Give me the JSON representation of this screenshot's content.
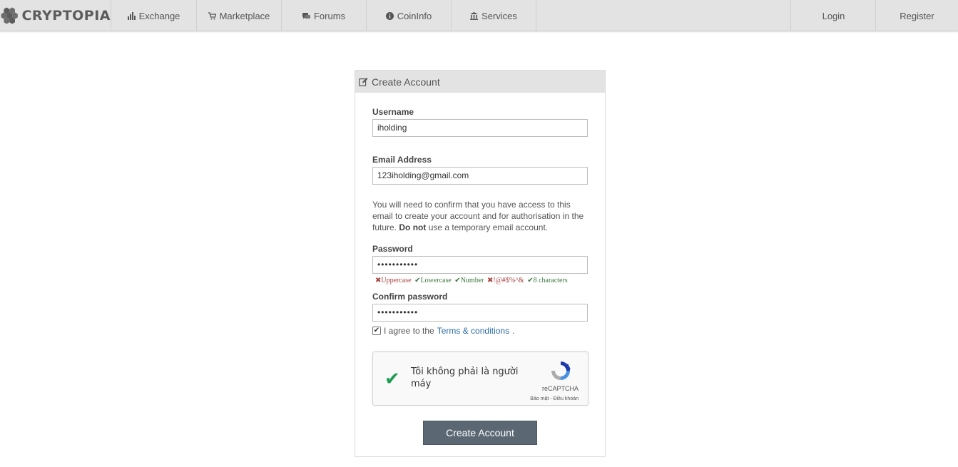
{
  "nav": {
    "brand": "CRYPTOPIA",
    "items": [
      {
        "label": "Exchange",
        "icon": "bar-chart-icon"
      },
      {
        "label": "Marketplace",
        "icon": "cart-icon"
      },
      {
        "label": "Forums",
        "icon": "comments-icon"
      },
      {
        "label": "CoinInfo",
        "icon": "info-circle-icon"
      },
      {
        "label": "Services",
        "icon": "bank-icon"
      }
    ],
    "login": "Login",
    "register": "Register"
  },
  "panel": {
    "title": "Create Account",
    "title_icon": "edit-icon"
  },
  "form": {
    "username_label": "Username",
    "username_value": "iholding",
    "email_label": "Email Address",
    "email_value": "123iholding@gmail.com",
    "email_help_1": "You will need to confirm that you have access to this email to create your account and for authorisation in the future. ",
    "email_help_bold": "Do not",
    "email_help_2": " use a temporary email account.",
    "password_label": "Password",
    "password_value": "•••••••••••",
    "password_rules": [
      {
        "text": "Uppercase",
        "status": "fail"
      },
      {
        "text": "Lowercase",
        "status": "pass"
      },
      {
        "text": "Number",
        "status": "pass"
      },
      {
        "text": "!@#$%^&",
        "status": "fail"
      },
      {
        "text": "8 characters",
        "status": "pass"
      }
    ],
    "confirm_label": "Confirm password",
    "confirm_value": "•••••••••••",
    "agree_checked": true,
    "agree_text": "I agree to the ",
    "terms_link": "Terms & conditions",
    "agree_suffix": ".",
    "submit_label": "Create Account"
  },
  "recaptcha": {
    "label": "Tôi không phải là người máy",
    "brand": "reCAPTCHA",
    "links": "Bảo mật - Điều khoản",
    "verified": true
  },
  "colors": {
    "nav_bg": "#e3e3e3",
    "button_bg": "#5b6873",
    "rule_fail": "#a94442",
    "rule_pass": "#3c763d",
    "link": "#2d6ca2",
    "recaptcha_check": "#1f9d55"
  }
}
